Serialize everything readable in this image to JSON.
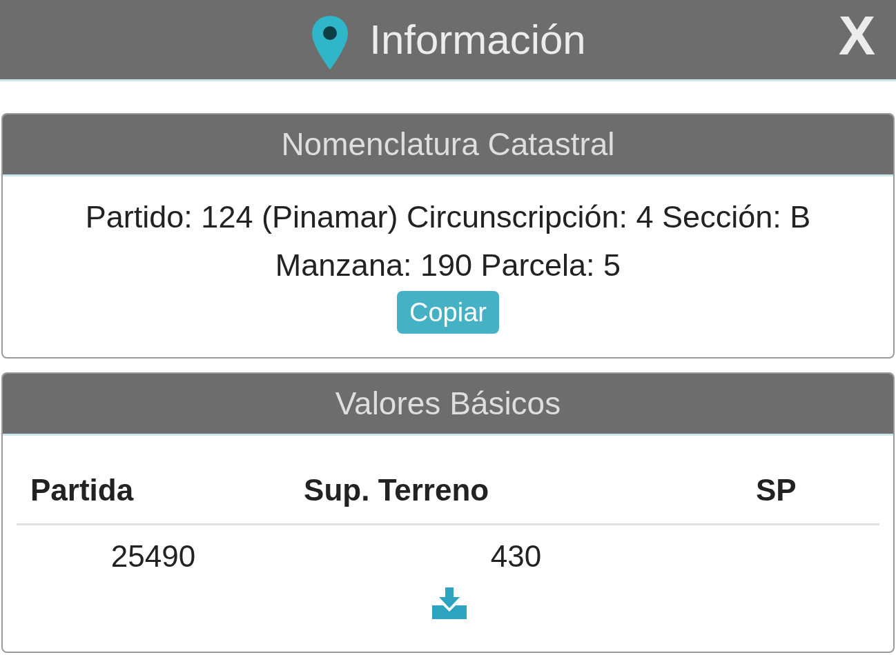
{
  "header": {
    "title": "Información",
    "close": "X"
  },
  "nomenclatura": {
    "title": "Nomenclatura Catastral",
    "lines": [
      "Partido: 124 (Pinamar) Circunscripción: 4 Sección: B",
      "Manzana: 190 Parcela: 5"
    ],
    "button": "Copiar"
  },
  "valores": {
    "title": "Valores Básicos",
    "columns": [
      "Partida",
      "Sup. Terreno",
      "SP"
    ],
    "rows": [
      [
        "25490",
        "430",
        ""
      ]
    ]
  }
}
